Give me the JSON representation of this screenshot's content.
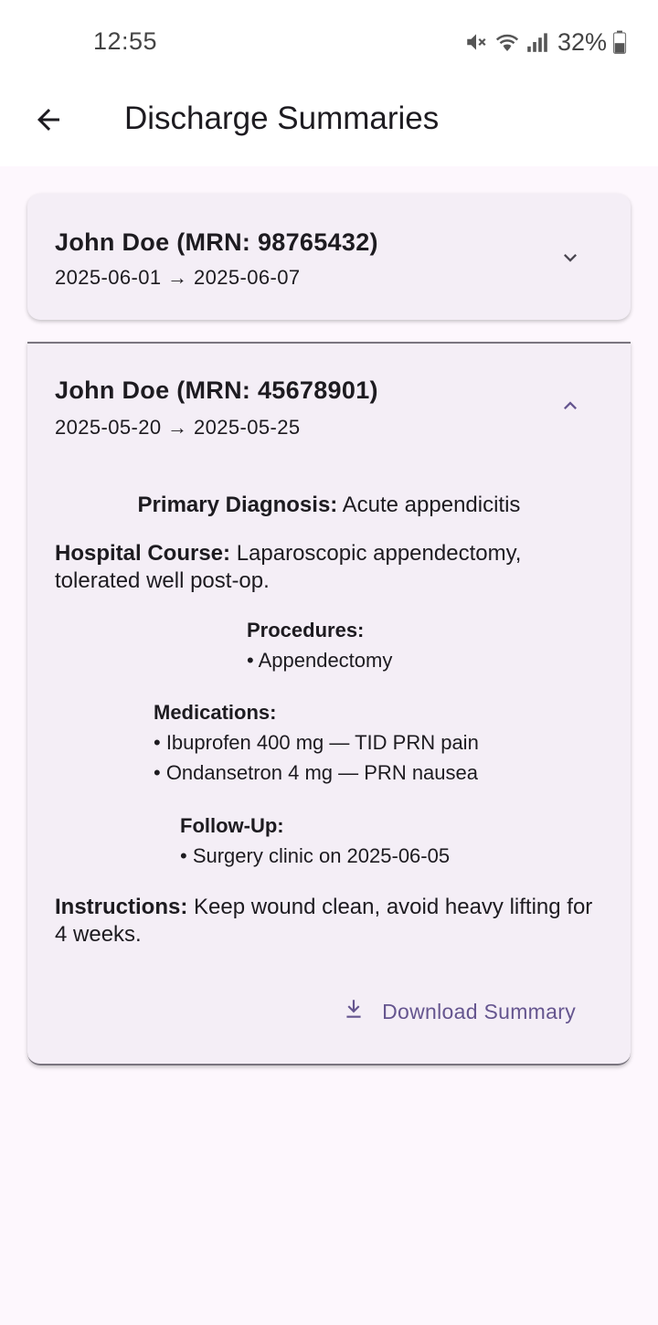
{
  "status": {
    "time": "12:55",
    "battery": "32%",
    "icons": [
      "mute-icon",
      "wifi-icon",
      "signal-icon",
      "battery-icon"
    ]
  },
  "app_bar": {
    "title": "Discharge Summaries",
    "back_icon": "arrow-left-icon"
  },
  "summaries": [
    {
      "title": "John Doe (MRN: 98765432)",
      "dates": "2025-06-01 → 2025-06-07",
      "expanded": false
    },
    {
      "title": "John Doe (MRN: 45678901)",
      "dates": "2025-05-20 → 2025-05-25",
      "expanded": true,
      "primary_diagnosis_label": "Primary Diagnosis:",
      "primary_diagnosis": "Acute appendicitis",
      "hospital_course_label": "Hospital Course:",
      "hospital_course": "Laparoscopic appendectomy, tolerated well post-op.",
      "procedures_label": "Procedures:",
      "procedures": [
        "• Appendectomy"
      ],
      "medications_label": "Medications:",
      "medications": [
        "• Ibuprofen 400 mg — TID PRN pain",
        "• Ondansetron 4 mg — PRN nausea"
      ],
      "followup_label": "Follow-Up:",
      "followup": [
        "• Surgery clinic on 2025-06-05"
      ],
      "instructions_label": "Instructions:",
      "instructions": "Keep wound clean, avoid heavy lifting for 4 weeks.",
      "download_label": "Download Summary"
    }
  ],
  "colors": {
    "background": "#fdf7fd",
    "card": "#f4eef6",
    "accent": "#65558f"
  }
}
